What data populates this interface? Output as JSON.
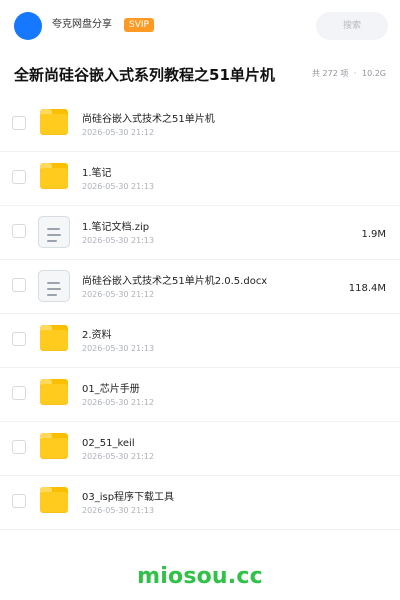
{
  "header": {
    "username": "夸克网盘分享",
    "vip_badge": "SVIP",
    "search_placeholder": "搜索",
    "avatar_color": "#1677ff",
    "vip_color": "#ff9b24"
  },
  "folder": {
    "title": "全新尚硅谷嵌入式系列教程之51单片机",
    "item_count": "共 272 项",
    "separator": "·",
    "total_size": "10.2G"
  },
  "files": [
    {
      "type": "folder",
      "icon": "folder-icon",
      "name": "尚硅谷嵌入式技术之51单片机",
      "time": "2026-05-30 21:12",
      "size": ""
    },
    {
      "type": "folder",
      "icon": "folder-icon",
      "name": "1.笔记",
      "time": "2026-05-30 21:13",
      "size": ""
    },
    {
      "type": "file",
      "icon": "document-icon",
      "name": "1.笔记文档.zip",
      "time": "2026-05-30 21:13",
      "size": "1.9M"
    },
    {
      "type": "file",
      "icon": "document-icon",
      "name": "尚硅谷嵌入式技术之51单片机2.0.5.docx",
      "time": "2026-05-30 21:12",
      "size": "118.4M"
    },
    {
      "type": "folder",
      "icon": "folder-icon",
      "name": "2.资料",
      "time": "2026-05-30 21:13",
      "size": ""
    },
    {
      "type": "folder",
      "icon": "folder-icon",
      "name": "01_芯片手册",
      "time": "2026-05-30 21:12",
      "size": ""
    },
    {
      "type": "folder",
      "icon": "folder-icon",
      "name": "02_51_keil",
      "time": "2026-05-30 21:12",
      "size": ""
    },
    {
      "type": "folder",
      "icon": "folder-icon",
      "name": "03_isp程序下载工具",
      "time": "2026-05-30 21:13",
      "size": ""
    }
  ],
  "footer": {
    "watermark": "miosou.cc",
    "watermark_color": "#2fc148"
  }
}
